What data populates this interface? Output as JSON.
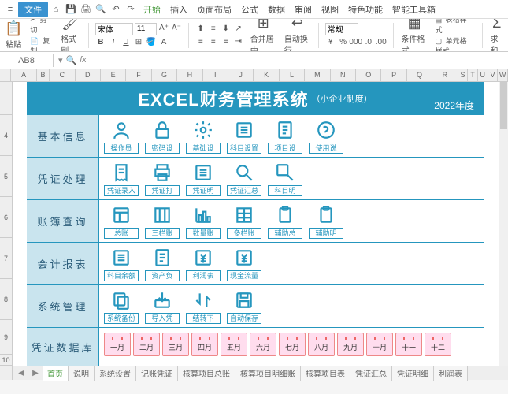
{
  "menubar": {
    "file": "文件",
    "tabs": [
      "开始",
      "插入",
      "页面布局",
      "公式",
      "数据",
      "审阅",
      "视图",
      "特色功能",
      "智能工具箱"
    ],
    "activeTab": 0
  },
  "ribbon": {
    "paste": "粘贴",
    "cut": "剪切",
    "copy": "复制",
    "formatPainter": "格式刷",
    "fontName": "宋体",
    "fontSize": "11",
    "merge": "合并居中",
    "wrap": "自动换行",
    "numFormat": "常规",
    "cond": "条件格式",
    "tableStyle": "表格样式",
    "cellStyle": "单元格样式",
    "sum": "求和"
  },
  "cellbar": {
    "ref": "AB8",
    "fx": "fx"
  },
  "cols": [
    "A",
    "B",
    "C",
    "D",
    "E",
    "F",
    "G",
    "H",
    "I",
    "J",
    "K",
    "L",
    "M",
    "N",
    "O",
    "P",
    "Q",
    "R",
    "S",
    "T",
    "U",
    "V",
    "W"
  ],
  "rows": {
    "r4": "4",
    "r5": "5",
    "r6": "6",
    "r7": "7",
    "r8": "8",
    "r9": "9",
    "r10": "10"
  },
  "banner": {
    "title": "EXCEL财务管理系统",
    "sub": "（小企业制度）",
    "year": "2022年度"
  },
  "sections": [
    {
      "label": "基本信息",
      "items": [
        "操作员",
        "密码设",
        "基础设",
        "科目设置",
        "项目设",
        "使用说"
      ]
    },
    {
      "label": "凭证处理",
      "items": [
        "凭证录入",
        "凭证打",
        "凭证明",
        "凭证汇总",
        "科目明"
      ]
    },
    {
      "label": "账簿查询",
      "items": [
        "总账",
        "三栏账",
        "数量账",
        "多栏账",
        "辅助总",
        "辅助明"
      ]
    },
    {
      "label": "会计报表",
      "items": [
        "科目余额",
        "资产负",
        "利润表",
        "现金流量"
      ]
    },
    {
      "label": "系统管理",
      "items": [
        "系统备份",
        "导入凭",
        "结转下",
        "自动保存"
      ]
    },
    {
      "label": "凭证数据库"
    }
  ],
  "months": [
    "一月",
    "二月",
    "三月",
    "四月",
    "五月",
    "六月",
    "七月",
    "八月",
    "九月",
    "十月",
    "十一",
    "十二"
  ],
  "sheetTabs": [
    "首页",
    "说明",
    "系统设置",
    "记账凭证",
    "核算项目总账",
    "核算项目明细账",
    "核算项目表",
    "凭证汇总",
    "凭证明细",
    "利润表"
  ],
  "activeSheet": 0
}
